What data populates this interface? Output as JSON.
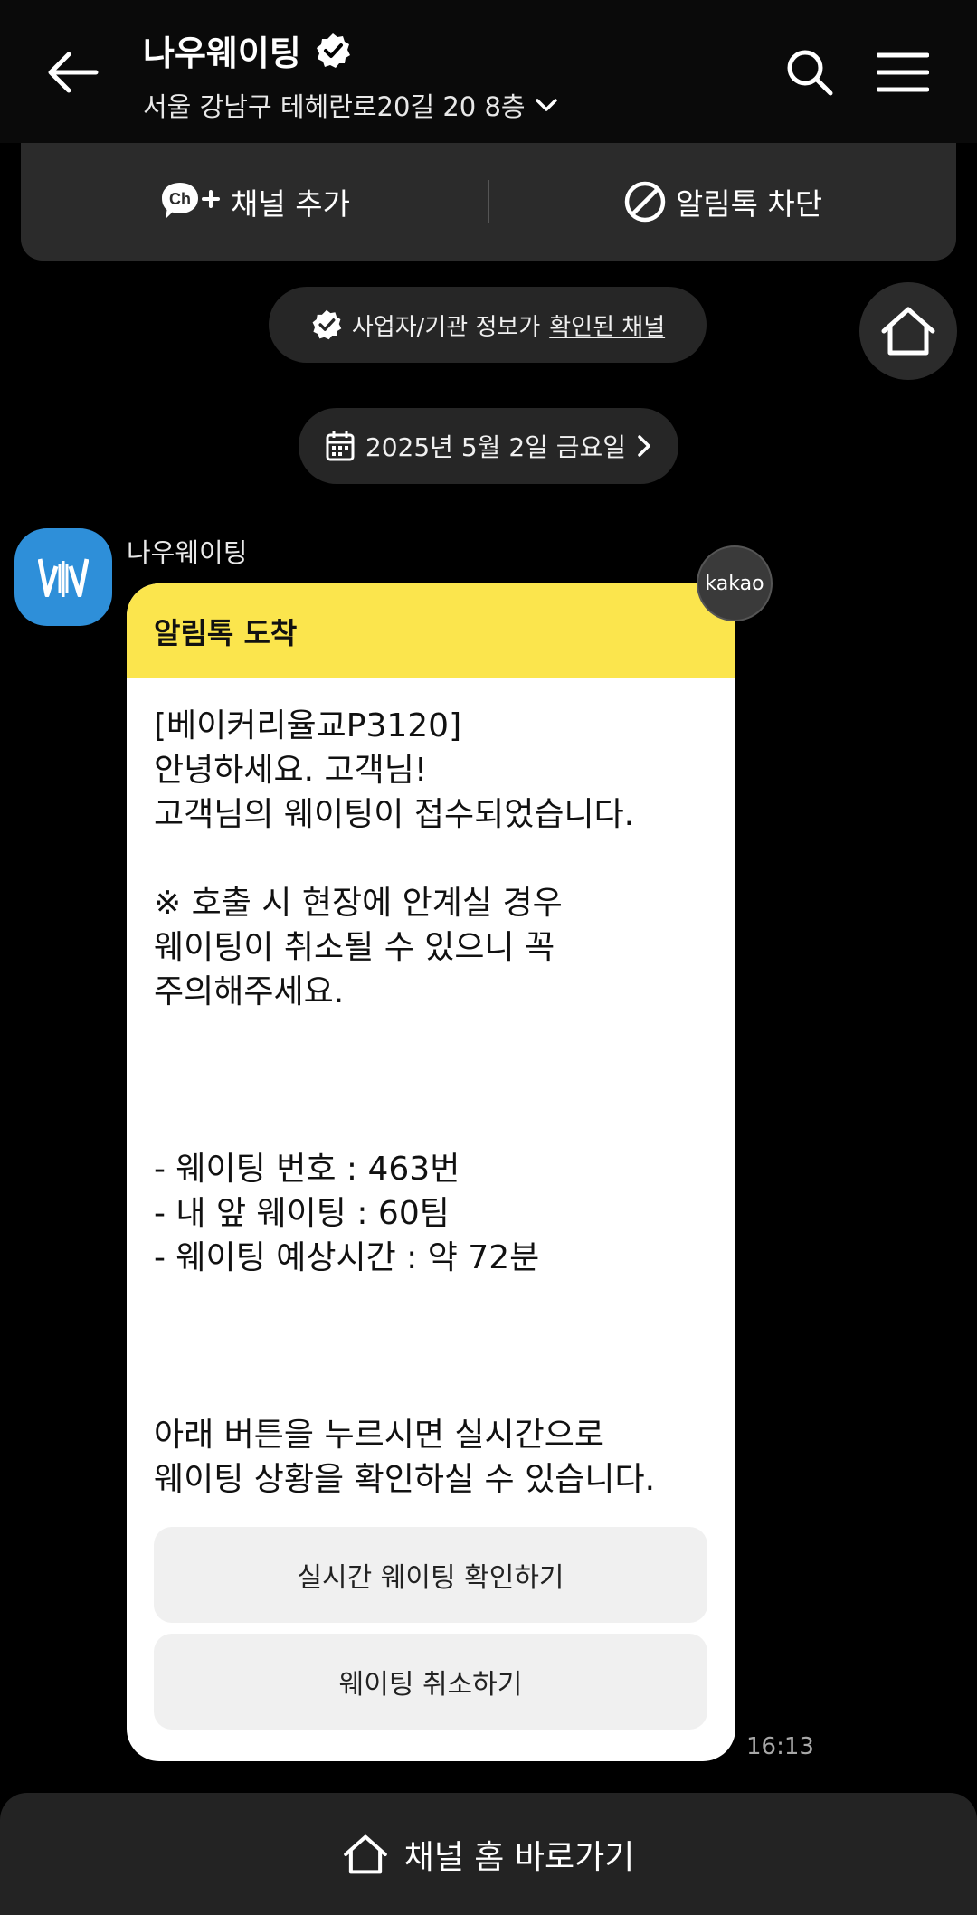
{
  "header": {
    "title": "나우웨이팅",
    "address": "서울 강남구 테헤란로20길 20 8층"
  },
  "actions": {
    "add_channel": "채널 추가",
    "block": "알림톡 차단",
    "ch_badge": "Ch"
  },
  "verified": {
    "prefix": "사업자/기관 정보가",
    "link": "확인된 채널"
  },
  "date_label": "2025년 5월 2일 금요일",
  "sender": {
    "name": "나우웨이팅",
    "badge": "kakao"
  },
  "message": {
    "header": "알림톡 도착",
    "lines": [
      "[베이커리율교P3120]",
      "안녕하세요. 고객님!",
      "고객님의 웨이팅이 접수되었습니다.",
      "",
      "※ 호출 시 현장에 안계실 경우",
      "웨이팅이 취소될 수 있으니 꼭",
      "주의해주세요.",
      "",
      "",
      "",
      "- 웨이팅 번호 : 463번",
      "- 내 앞 웨이팅 : 60팀",
      "- 웨이팅 예상시간 : 약 72분",
      "",
      "",
      "",
      "아래 버튼을 누르시면 실시간으로",
      "웨이팅 상황을 확인하실 수 있습니다."
    ],
    "button_primary": "실시간 웨이팅 확인하기",
    "button_secondary": "웨이팅 취소하기",
    "time": "16:13"
  },
  "bottom_bar": {
    "label": "채널 홈 바로가기"
  },
  "colors": {
    "background": "#000000",
    "panel": "#2b2b2b",
    "bubble_header": "#fbe54d",
    "avatar": "#2e8fd9"
  }
}
